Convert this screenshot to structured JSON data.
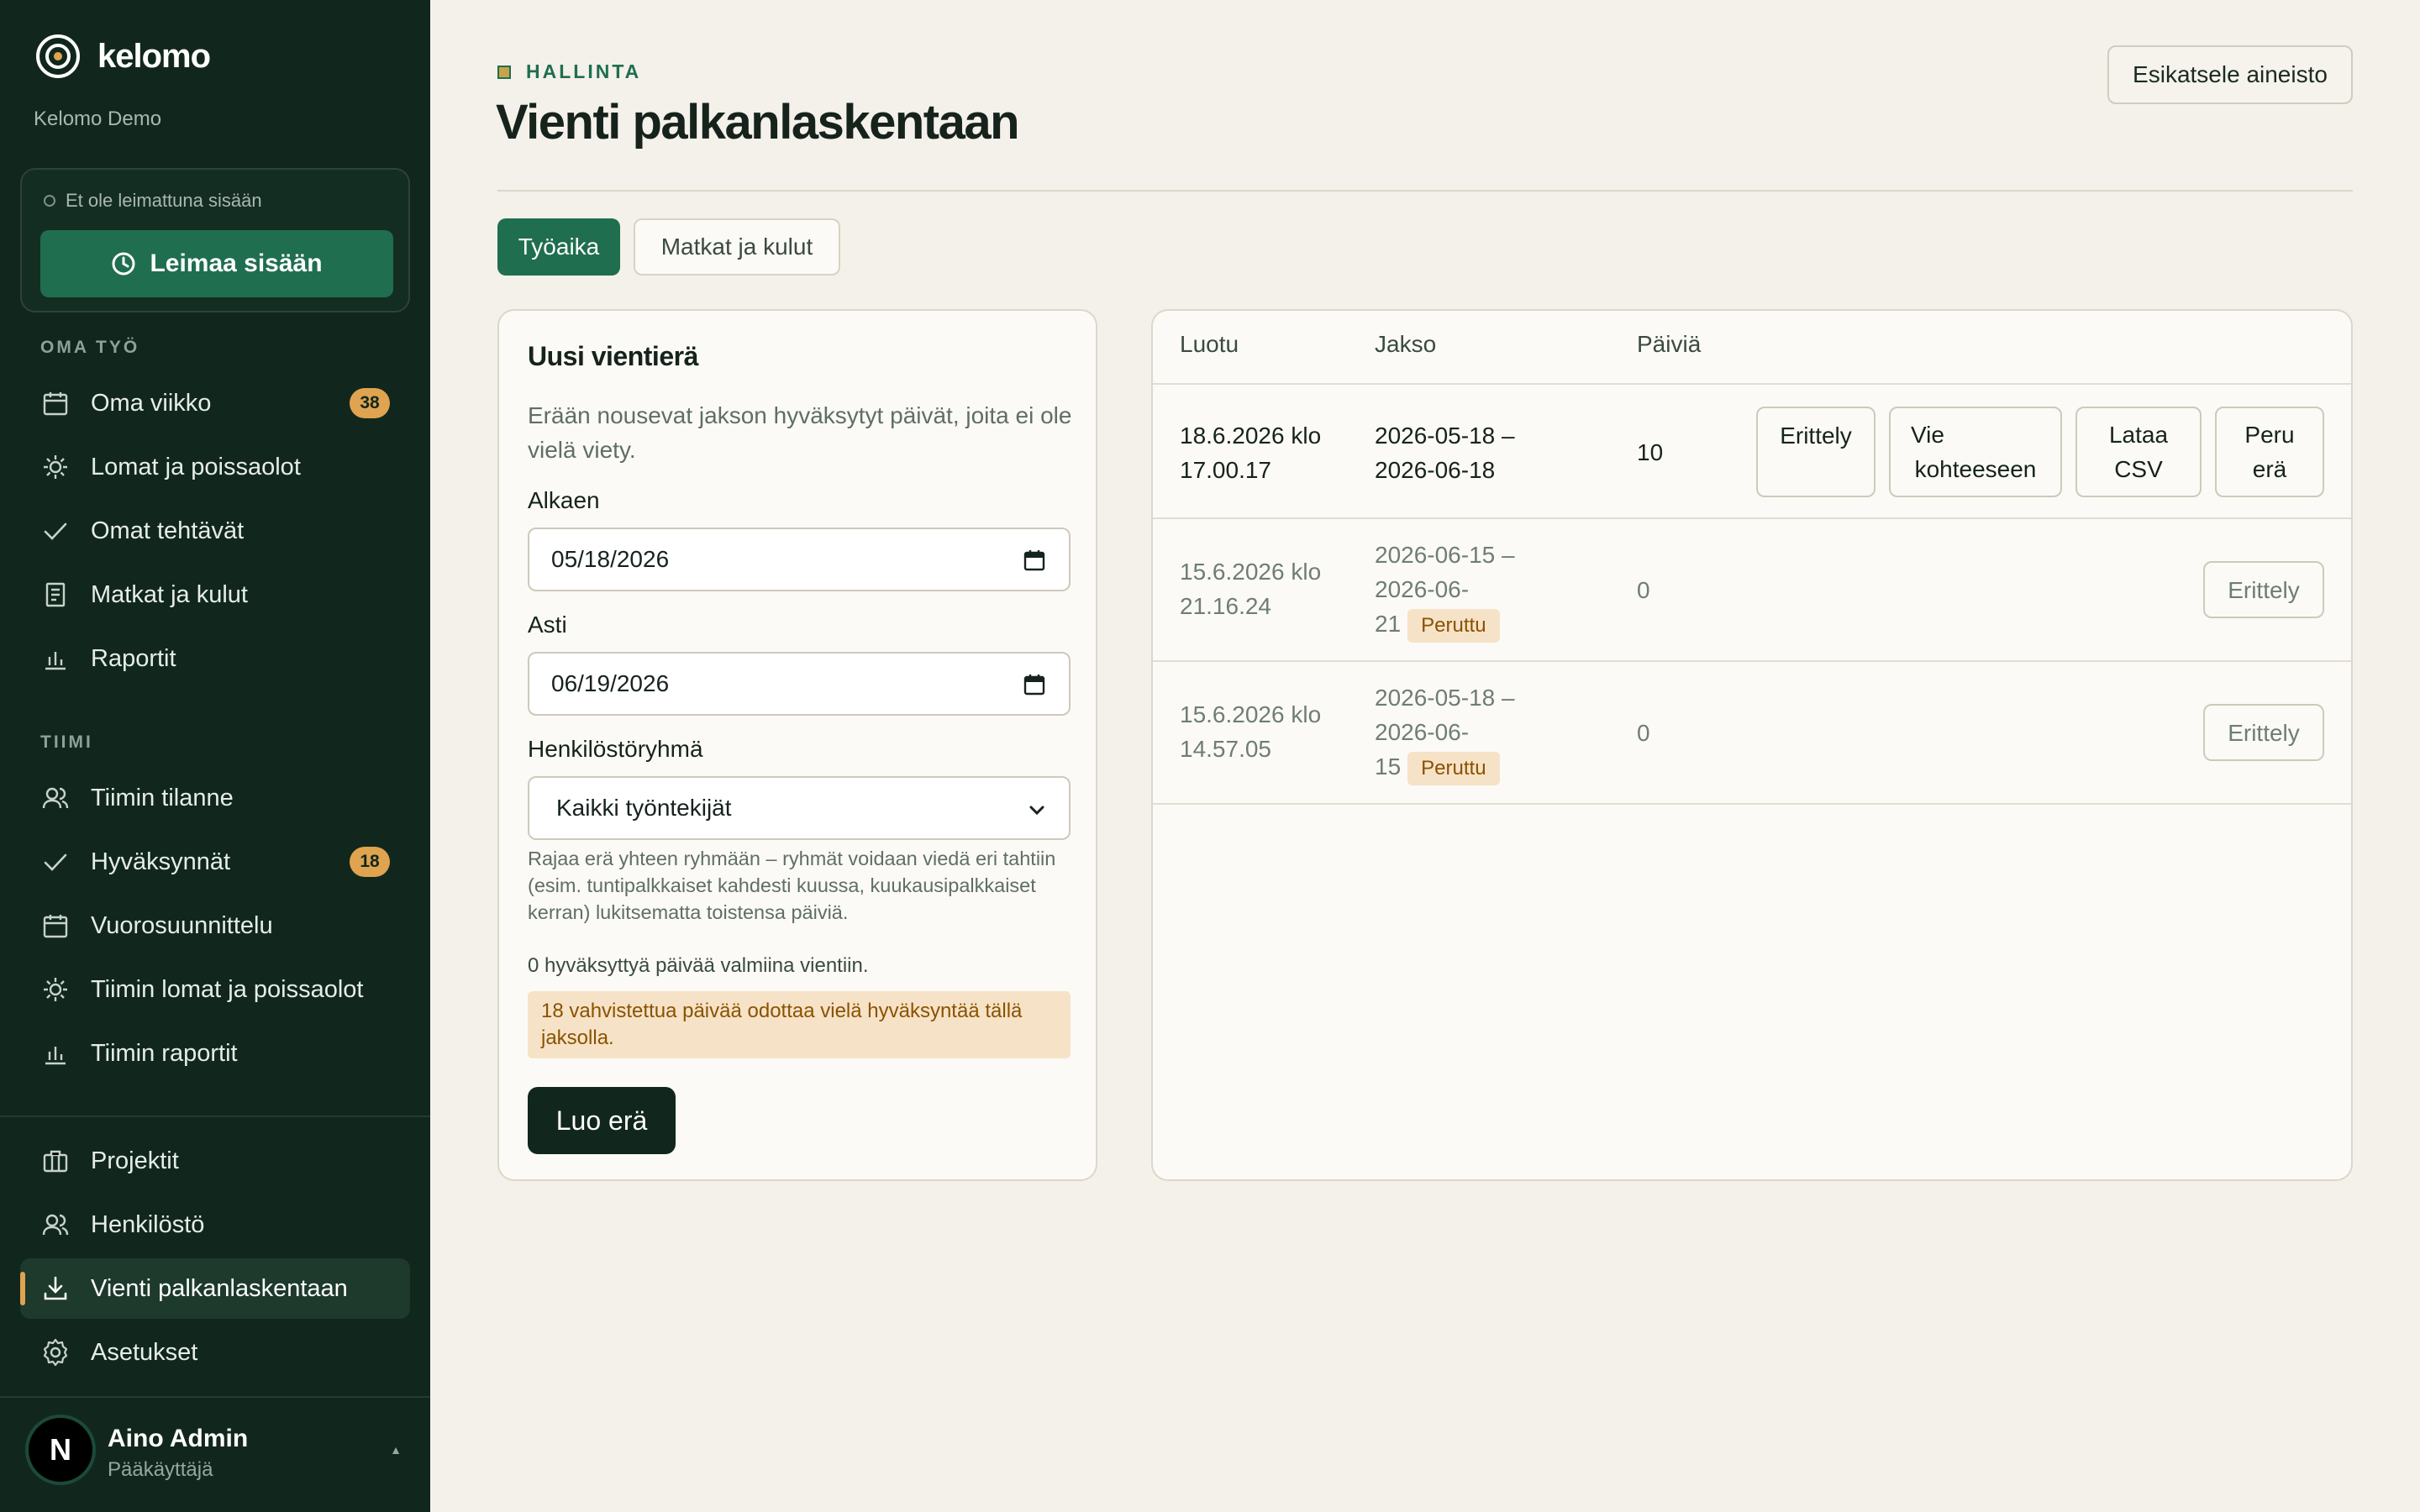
{
  "brand": {
    "name": "kelomo",
    "org": "Kelomo Demo"
  },
  "punch": {
    "status": "Et ole leimattuna sisään",
    "button": "Leimaa sisään"
  },
  "sidebar": {
    "section_own": "OMA TYÖ",
    "own_items": [
      {
        "label": "Oma viikko",
        "icon": "calendar-icon",
        "badge": "38"
      },
      {
        "label": "Lomat ja poissaolot",
        "icon": "sun-icon"
      },
      {
        "label": "Omat tehtävät",
        "icon": "check-icon"
      },
      {
        "label": "Matkat ja kulut",
        "icon": "receipt-icon"
      },
      {
        "label": "Raportit",
        "icon": "bar-chart-icon"
      }
    ],
    "section_team": "TIIMI",
    "team_items": [
      {
        "label": "Tiimin tilanne",
        "icon": "users-icon"
      },
      {
        "label": "Hyväksynnät",
        "icon": "check-icon",
        "badge": "18"
      },
      {
        "label": "Vuorosuunnittelu",
        "icon": "calendar-icon"
      },
      {
        "label": "Tiimin lomat ja poissaolot",
        "icon": "sun-icon"
      },
      {
        "label": "Tiimin raportit",
        "icon": "bar-chart-icon"
      }
    ],
    "admin_items": [
      {
        "label": "Projektit",
        "icon": "briefcase-icon"
      },
      {
        "label": "Henkilöstö",
        "icon": "users-icon"
      },
      {
        "label": "Vienti palkanlaskentaan",
        "icon": "download-icon",
        "active": true
      },
      {
        "label": "Asetukset",
        "icon": "gear-icon"
      }
    ]
  },
  "user": {
    "initial": "N",
    "name": "Aino Admin",
    "role": "Pääkäyttäjä",
    "caret": "▲"
  },
  "header": {
    "eyebrow": "HALLINTA",
    "title": "Vienti palkanlaskentaan",
    "preview_button": "Esikatsele aineisto"
  },
  "tabs": [
    {
      "label": "Työaika",
      "active": true
    },
    {
      "label": "Matkat ja kulut",
      "active": false
    }
  ],
  "form": {
    "title": "Uusi vientierä",
    "description": "Erään nousevat jakson hyväksytyt päivät, joita ei ole vielä viety.",
    "from_label": "Alkaen",
    "from_value": "05/18/2026",
    "to_label": "Asti",
    "to_value": "06/19/2026",
    "group_label": "Henkilöstöryhmä",
    "group_value": "Kaikki työntekijät",
    "help": "Rajaa erä yhteen ryhmään – ryhmät voidaan viedä eri tahtiin (esim. tuntipalkkaiset kahdesti kuussa, kuukausipalkkaiset kerran) lukitsematta toistensa päiviä.",
    "ready": "0 hyväksyttyä päivää valmiina vientiin.",
    "warning": "18 vahvistettua päivää odottaa vielä hyväksyntää tällä jaksolla.",
    "create_button": "Luo erä"
  },
  "table": {
    "headers": [
      "Luotu",
      "Jakso",
      "Päiviä"
    ],
    "rows": [
      {
        "created_1": "18.6.2026 klo",
        "created_2": "17.00.17",
        "period_1": "2026-05-18 –",
        "period_2": "2026-06-18",
        "days": "10",
        "actions": {
          "detail": "Erittely",
          "target_1": "Vie",
          "target_2": "kohteeseen",
          "csv_1": "Lataa",
          "csv_2": "CSV",
          "cancel_1": "Peru",
          "cancel_2": "erä"
        }
      },
      {
        "created_1": "15.6.2026 klo",
        "created_2": "21.16.24",
        "period_1": "2026-06-15 –",
        "period_2": "2026-06-",
        "period_3": "21",
        "tag": "Peruttu",
        "days": "0",
        "detail": "Erittely"
      },
      {
        "created_1": "15.6.2026 klo",
        "created_2": "14.57.05",
        "period_1": "2026-05-18 –",
        "period_2": "2026-06-",
        "period_3": "15",
        "tag": "Peruttu",
        "days": "0",
        "detail": "Erittely"
      }
    ]
  },
  "colors": {
    "sidebar_bg": "#11271d",
    "accent": "#1f6e4f",
    "badge": "#e0a34f",
    "page_bg": "#f4f1ea",
    "warning_bg": "#f6e2c7",
    "warning_text": "#8a5200"
  }
}
